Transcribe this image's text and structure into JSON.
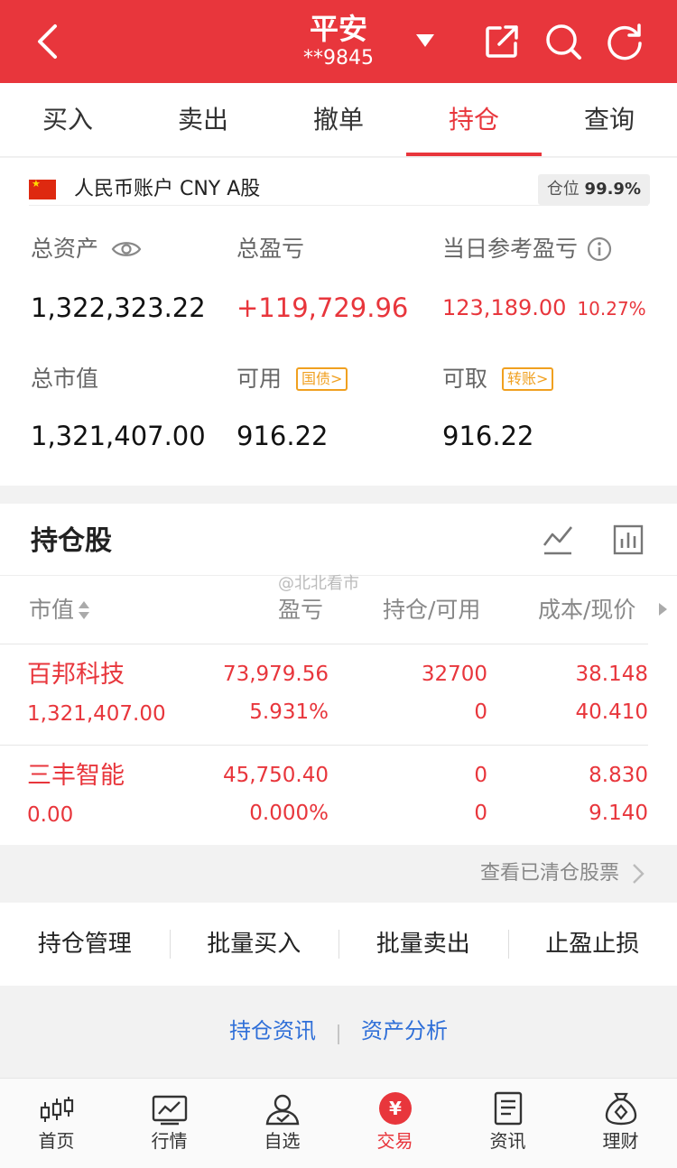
{
  "header": {
    "title": "平安",
    "account_masked": "**9845",
    "icons": [
      "back-arrow-icon",
      "dropdown-triangle-icon",
      "share-icon",
      "search-icon",
      "refresh-icon"
    ]
  },
  "tabs": [
    {
      "label": "买入",
      "active": false
    },
    {
      "label": "卖出",
      "active": false
    },
    {
      "label": "撤单",
      "active": false
    },
    {
      "label": "持仓",
      "active": true
    },
    {
      "label": "查询",
      "active": false
    }
  ],
  "account": {
    "label": "人民币账户 CNY A股",
    "position_label": "仓位",
    "position_value": "99.9%",
    "total_assets_label": "总资产",
    "total_assets": "1,322,323.22",
    "total_pl_label": "总盈亏",
    "total_pl": "+119,729.96",
    "daily_pl_label": "当日参考盈亏",
    "daily_pl": "123,189.00",
    "daily_pl_pct": "10.27%",
    "market_value_label": "总市值",
    "market_value": "1,321,407.00",
    "available_label": "可用",
    "available_chip": "国债",
    "available": "916.22",
    "withdrawable_label": "可取",
    "withdrawable_chip": "转账",
    "withdrawable": "916.22"
  },
  "holdings": {
    "title": "持仓股",
    "watermark": "@北北看市",
    "columns": [
      "市值",
      "盈亏",
      "持仓/可用",
      "成本/现价"
    ],
    "rows": [
      {
        "name": "百邦科技",
        "market_value": "1,321,407.00",
        "pl": "73,979.56",
        "pl_pct": "5.931%",
        "holding": "32700",
        "available": "0",
        "cost": "38.148",
        "price": "40.410"
      },
      {
        "name": "三丰智能",
        "market_value": "0.00",
        "pl": "45,750.40",
        "pl_pct": "0.000%",
        "holding": "0",
        "available": "0",
        "cost": "8.830",
        "price": "9.140"
      }
    ],
    "cleared_link": "查看已清仓股票"
  },
  "tools": [
    "持仓管理",
    "批量买入",
    "批量卖出",
    "止盈止损"
  ],
  "links": [
    "持仓资讯",
    "资产分析"
  ],
  "nav": [
    {
      "label": "首页",
      "icon": "candlestick-icon",
      "active": false
    },
    {
      "label": "行情",
      "icon": "chart-icon",
      "active": false
    },
    {
      "label": "自选",
      "icon": "user-check-icon",
      "active": false
    },
    {
      "label": "交易",
      "icon": "yuan-icon",
      "active": true
    },
    {
      "label": "资讯",
      "icon": "document-icon",
      "active": false
    },
    {
      "label": "理财",
      "icon": "money-bag-icon",
      "active": false
    }
  ],
  "colors": {
    "brand_red": "#e8363c",
    "link_blue": "#2f6fd8",
    "chip_orange": "#f0a020"
  }
}
